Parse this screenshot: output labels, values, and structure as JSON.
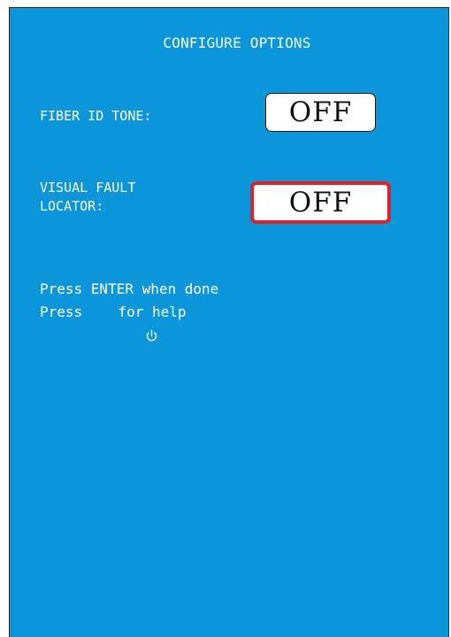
{
  "screen": {
    "title": "CONFIGURE OPTIONS",
    "options": [
      {
        "label": "FIBER ID TONE:",
        "value": "OFF",
        "selected": false
      },
      {
        "label": "VISUAL FAULT\nLOCATOR:",
        "value": "OFF",
        "selected": true
      }
    ],
    "help": {
      "line1": "Press ENTER when done",
      "line2_prefix": "Press ",
      "line2_icon": "power-icon",
      "line2_suffix": " for help"
    }
  },
  "colors": {
    "background": "#0a96d9",
    "text": "#ffffff",
    "selection_border": "#e0202a",
    "toggle_fill": "#ffffff"
  }
}
